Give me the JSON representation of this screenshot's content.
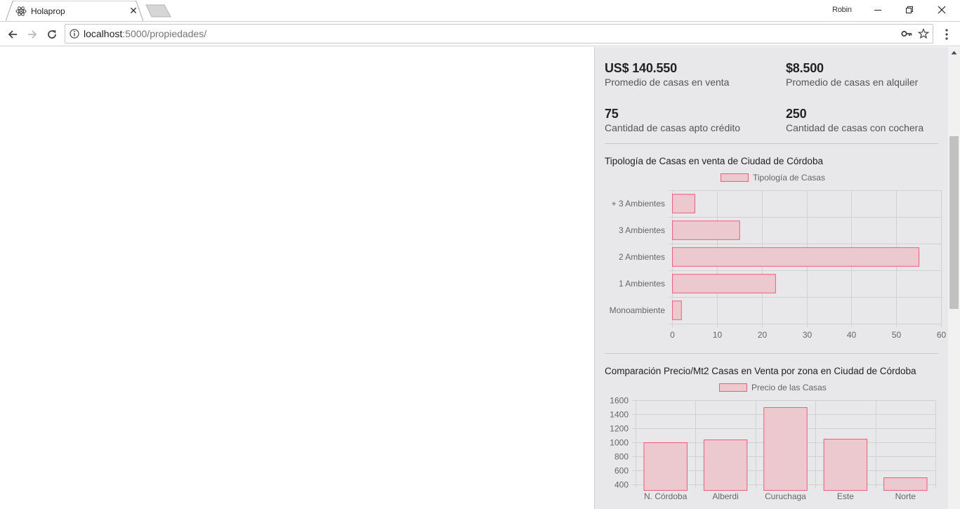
{
  "browser": {
    "tab_title": "Holaprop",
    "profile_name": "Robin",
    "url_host": "localhost",
    "url_path": ":5000/propiedades/"
  },
  "stats": [
    {
      "value": "US$ 140.550",
      "label": "Promedio de casas en venta"
    },
    {
      "value": "$8.500",
      "label": "Promedio de casas en alquiler"
    },
    {
      "value": "75",
      "label": "Cantidad de casas apto crédito"
    },
    {
      "value": "250",
      "label": "Cantidad de casas con cochera"
    }
  ],
  "colors": {
    "bar_fill": "#ecc8cf",
    "bar_stroke": "#ef5c7c",
    "panel_bg": "#e8e8ea",
    "grid": "#d2d2d4"
  },
  "chart_data": [
    {
      "type": "bar",
      "orientation": "horizontal",
      "title": "Tipología de Casas en venta de Ciudad de Córdoba",
      "legend": {
        "label": "Tipología de Casas",
        "position": "top"
      },
      "categories": [
        "+ 3 Ambientes",
        "3 Ambientes",
        "2 Ambientes",
        "1 Ambientes",
        "Monoambiente"
      ],
      "values": [
        5,
        15,
        55,
        23,
        2
      ],
      "xlim": [
        0,
        60
      ],
      "ticks": [
        0,
        10,
        20,
        30,
        40,
        50,
        60
      ],
      "grid": true
    },
    {
      "type": "bar",
      "orientation": "vertical",
      "title": "Comparación Precio/Mt2 Casas en Venta por zona en Ciudad de Córdoba",
      "legend": {
        "label": "Precio de las Casas",
        "position": "top"
      },
      "categories": [
        "N. Córdoba",
        "Alberdi",
        "Curuchaga",
        "Este",
        "Norte"
      ],
      "values": [
        1000,
        1040,
        1500,
        1050,
        500
      ],
      "ylim_visible": [
        400,
        1600
      ],
      "ticks": [
        400,
        600,
        800,
        1000,
        1200,
        1400,
        1600
      ],
      "grid": true
    }
  ]
}
